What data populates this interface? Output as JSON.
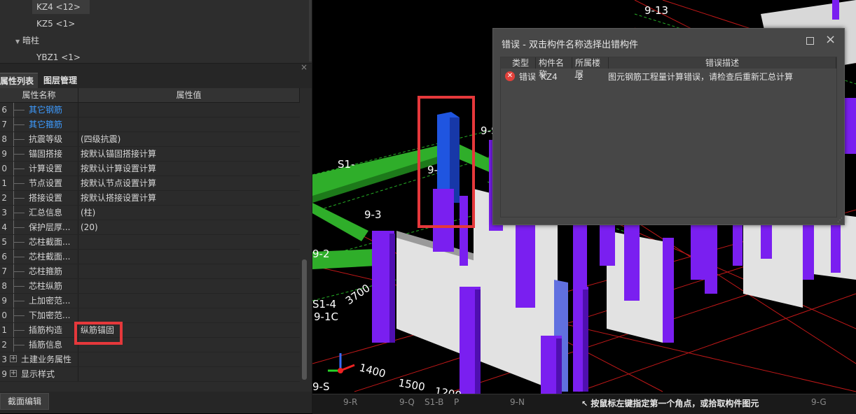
{
  "tree": {
    "items": [
      {
        "label": "KZ4 <12>",
        "selected": true
      },
      {
        "label": "KZ5 <1>",
        "selected": false
      },
      {
        "label": "暗柱",
        "group": true
      },
      {
        "label": "YBZ1 <1>",
        "selected": false
      }
    ]
  },
  "tabs": [
    "属性列表",
    "图层管理"
  ],
  "grid": {
    "headers": [
      "属性名称",
      "属性值"
    ],
    "rows": [
      {
        "idx": "6",
        "name": "其它钢筋",
        "value": "",
        "blue": true
      },
      {
        "idx": "7",
        "name": "其它箍筋",
        "value": "",
        "blue": true
      },
      {
        "idx": "8",
        "name": "抗震等级",
        "value": "(四级抗震)"
      },
      {
        "idx": "9",
        "name": "锚固搭接",
        "value": "按默认锚固搭接计算"
      },
      {
        "idx": "0",
        "name": "计算设置",
        "value": "按默认计算设置计算"
      },
      {
        "idx": "1",
        "name": "节点设置",
        "value": "按默认节点设置计算"
      },
      {
        "idx": "2",
        "name": "搭接设置",
        "value": "按默认搭接设置计算"
      },
      {
        "idx": "3",
        "name": "汇总信息",
        "value": "(柱)"
      },
      {
        "idx": "4",
        "name": "保护层厚...",
        "value": "(20)"
      },
      {
        "idx": "5",
        "name": "芯柱截面...",
        "value": ""
      },
      {
        "idx": "6",
        "name": "芯柱截面...",
        "value": ""
      },
      {
        "idx": "7",
        "name": "芯柱箍筋",
        "value": ""
      },
      {
        "idx": "8",
        "name": "芯柱纵筋",
        "value": ""
      },
      {
        "idx": "9",
        "name": "上加密范...",
        "value": ""
      },
      {
        "idx": "0",
        "name": "下加密范...",
        "value": ""
      },
      {
        "idx": "1",
        "name": "插筋构造",
        "value": "纵筋锚固"
      },
      {
        "idx": "2",
        "name": "插筋信息",
        "value": ""
      },
      {
        "idx": "3",
        "name": "土建业务属性",
        "value": "",
        "expander": true
      },
      {
        "idx": "9",
        "name": "显示样式",
        "value": "",
        "expander": true
      }
    ]
  },
  "bottom": {
    "section_edit": "截面编辑"
  },
  "dialog": {
    "title": "错误 - 双击构件名称选择出错构件",
    "headers": [
      "类型",
      "构件名称",
      "所属楼层",
      "错误描述"
    ],
    "row": {
      "type": "错误",
      "name": "KZ4",
      "floor": "-2",
      "desc": "图元钢筋工程量计算错误，请检查后重新汇总计算"
    }
  },
  "status": {
    "hint": "按鼠标左键指定第一个角点，或拾取构件图元",
    "axes": [
      "9-R",
      "9-Q",
      "S1-B",
      "P",
      "9-N",
      "9-G"
    ]
  },
  "viewport_labels": [
    "9-13",
    "S1-",
    "9-",
    "9-3",
    "9-2",
    "S1-4",
    "9-1C",
    "3700",
    "1400",
    "1500",
    "1200",
    "9-S",
    "9-S"
  ],
  "colors": {
    "accent_red": "#e5383b",
    "link_blue": "#3d9bff",
    "column_purple": "#7a1ff0",
    "column_blue": "#1f55e0",
    "beam_green": "#2fae2a"
  }
}
